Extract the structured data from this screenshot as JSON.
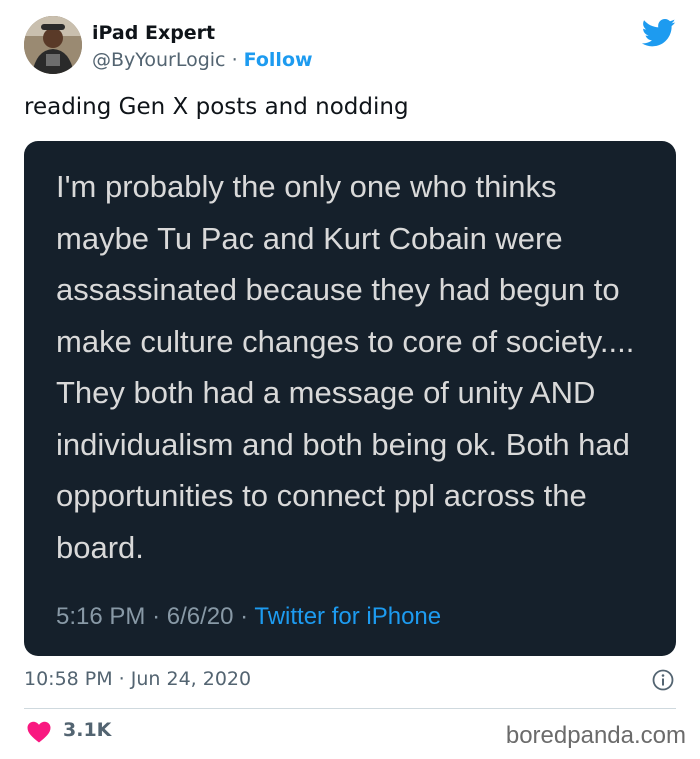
{
  "author": {
    "name": "iPad Expert",
    "handle": "@ByYourLogic",
    "separator": "·",
    "follow_label": "Follow"
  },
  "tweet": {
    "text": "reading Gen X posts and nodding",
    "timestamp": "10:58 PM · Jun 24, 2020",
    "likes": "3.1K"
  },
  "quoted": {
    "text": "I'm probably the only one who thinks maybe Tu Pac and Kurt Cobain were assassinated because they had begun to make culture changes to core of society.... They both had a message of unity AND individualism and both being ok. Both had opportunities to connect ppl across the board.",
    "time": "5:16 PM",
    "date": "6/6/20",
    "separator": "·",
    "source": "Twitter for iPhone"
  },
  "watermark": "boredpanda.com",
  "icons": {
    "brand": "twitter-bird-icon",
    "info": "info-icon",
    "like": "heart-icon"
  },
  "colors": {
    "accent": "#1d9bf0",
    "quote_bg": "#15202b",
    "heart": "#f91880",
    "muted": "#536471"
  }
}
